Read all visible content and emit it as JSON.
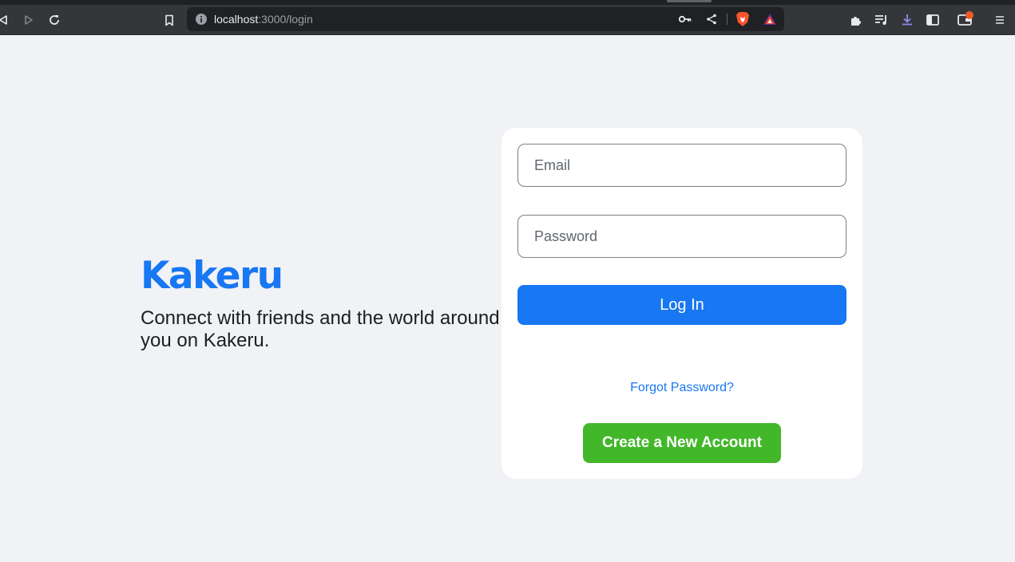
{
  "browser": {
    "url_host": "localhost",
    "url_path": ":3000/login"
  },
  "icons": {
    "back": "back-arrow-icon",
    "forward": "forward-arrow-icon",
    "reload": "reload-icon",
    "bookmark": "bookmark-icon",
    "site_info": "info-icon",
    "key": "key-icon",
    "share": "share-icon",
    "brave_shields": "brave-lion-icon",
    "brave_rewards": "triangle-rewards-icon",
    "extensions": "puzzle-icon",
    "media": "playlist-icon",
    "downloads": "download-icon",
    "sidebar": "sidebar-icon",
    "wallet": "wallet-icon",
    "menu": "hamburger-menu-icon"
  },
  "brand": {
    "name": "Kakeru",
    "tagline": "Connect with friends and the world around you on Kakeru."
  },
  "login_form": {
    "email_placeholder": "Email",
    "password_placeholder": "Password",
    "login_label": "Log In",
    "forgot_label": "Forgot Password?",
    "create_label": "Create a New Account"
  },
  "colors": {
    "brand_blue": "#1877f2",
    "create_green": "#42b72a",
    "page_bg": "#f0f2f5"
  }
}
